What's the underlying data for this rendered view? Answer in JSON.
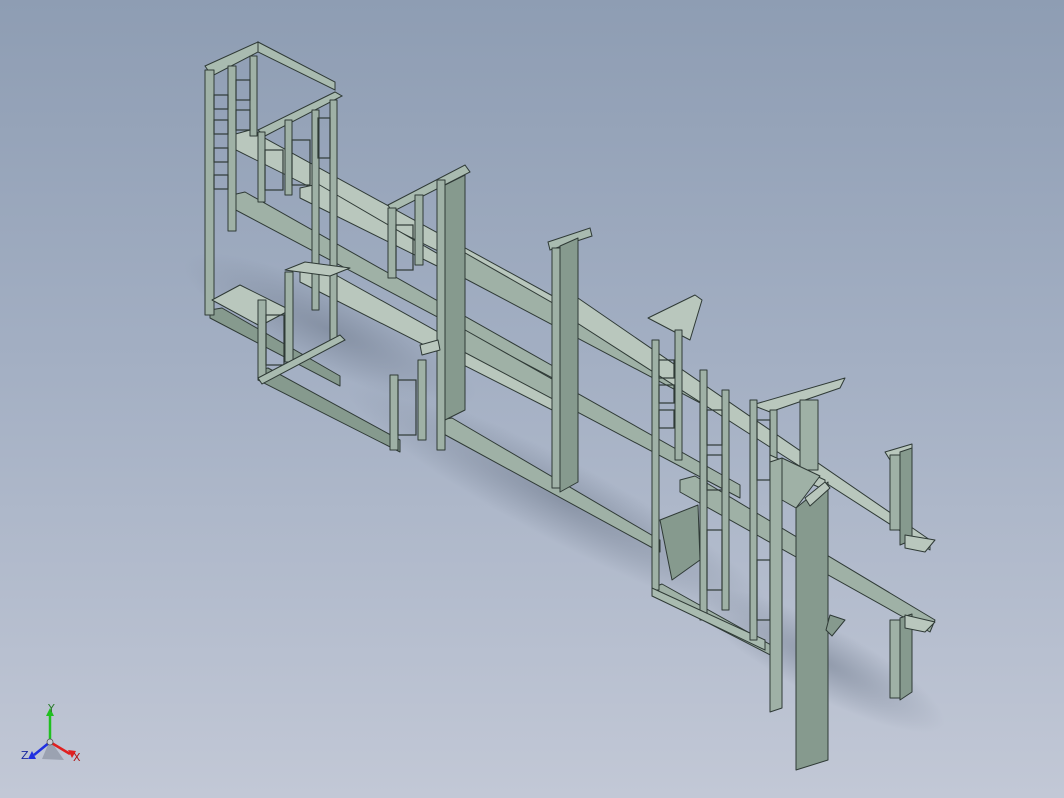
{
  "viewport": {
    "background_top": "#8e9db3",
    "background_bottom": "#c2c8d6",
    "model_color": "#9fb1a6",
    "edge_color": "#2f3a36"
  },
  "model": {
    "icon": "steel-frame-structure-icon"
  },
  "triad": {
    "x_label": "X",
    "y_label": "Y",
    "z_label": "Z",
    "x_color": "#e02020",
    "y_color": "#20c020",
    "z_color": "#2030e0"
  }
}
